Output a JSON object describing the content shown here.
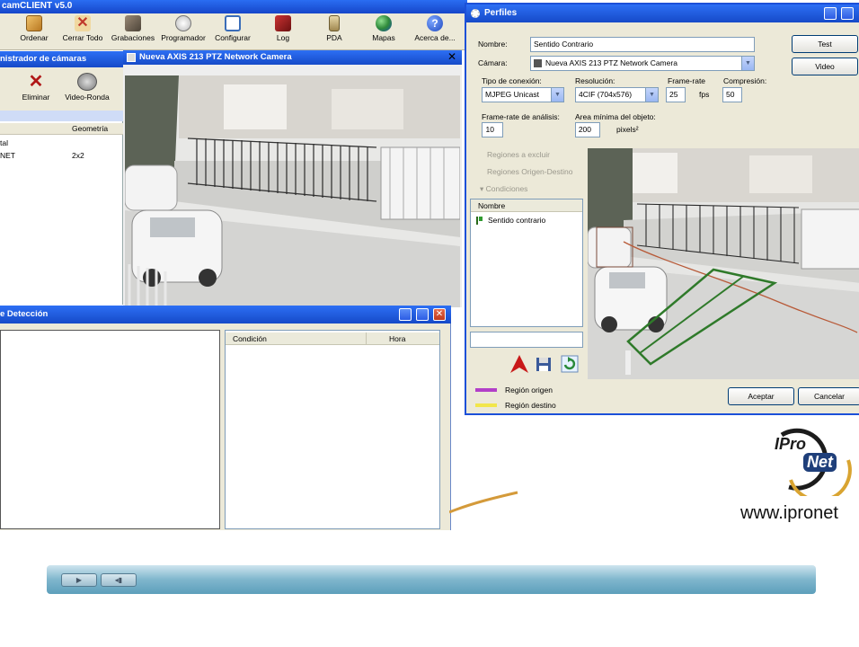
{
  "app": {
    "title": "camCLIENT v5.0",
    "toolbar": [
      {
        "label": "Ordenar",
        "icon": "ordenar-icon",
        "color": "#c98a2c"
      },
      {
        "label": "Cerrar Todo",
        "icon": "cerrar-todo-icon",
        "color": "#c0392b"
      },
      {
        "label": "Grabaciones",
        "icon": "grabaciones-icon",
        "color": "#7a6a5a"
      },
      {
        "label": "Programador",
        "icon": "programador-icon",
        "color": "#b0b0b0"
      },
      {
        "label": "Configurar",
        "icon": "configurar-icon",
        "color": "#3a6db8"
      },
      {
        "label": "Log",
        "icon": "log-icon",
        "color": "#8b1a1a"
      },
      {
        "label": "PDA",
        "icon": "pda-icon",
        "color": "#c9b27a"
      },
      {
        "label": "Mapas",
        "icon": "globe-icon",
        "color": "#2f8a3a"
      },
      {
        "label": "Acerca de...",
        "icon": "help-icon",
        "color": "#2a5cc8"
      }
    ]
  },
  "cam_admin": {
    "title": "nistrador de cámaras",
    "tools": [
      {
        "label": "Eliminar",
        "icon": "delete-x-icon"
      },
      {
        "label": "Video-Ronda",
        "icon": "video-ronda-icon"
      }
    ],
    "columns": [
      "Geometría"
    ],
    "rows": [
      {
        "name": "tal",
        "geometry": ""
      },
      {
        "name": "NET",
        "geometry": "2x2"
      }
    ]
  },
  "camera_window": {
    "title": "Nueva AXIS 213 PTZ Network Camera"
  },
  "detection_window": {
    "title": "e Detección",
    "columns": [
      "Condición",
      "Hora"
    ]
  },
  "perfiles": {
    "title": "Perfiles",
    "nombre_label": "Nombre:",
    "nombre_value": "Sentido Contrario",
    "camara_label": "Cámara:",
    "camara_value": "Nueva AXIS 213 PTZ Network Camera",
    "tipo_label": "Tipo de conexión:",
    "tipo_value": "MJPEG Unicast",
    "resolucion_label": "Resolución:",
    "resolucion_value": "4CIF (704x576)",
    "framerate_label": "Frame-rate",
    "framerate_value": "25",
    "fps": "fps",
    "compresion_label": "Compresión:",
    "compresion_value": "50",
    "fr_analisis_label": "Frame-rate de análisis:",
    "fr_analisis_value": "10",
    "area_label": "Area mínima del objeto:",
    "area_value": "200",
    "pixels": "pixels²",
    "tree": [
      "Regiones a excluir",
      "Regiones Origen-Destino",
      "Condiciones"
    ],
    "list_header": "Nombre",
    "list_items": [
      "Sentido contrario"
    ],
    "test": "Test",
    "video": "Video",
    "aceptar": "Aceptar",
    "cancelar": "Cancelar",
    "legend": [
      {
        "label": "Región origen",
        "color": "#b23fc8"
      },
      {
        "label": "Región destino",
        "color": "#f2e64a"
      }
    ]
  },
  "brand": {
    "logo_text_top": "IPro",
    "logo_text_bottom": "Net",
    "url": "www.ipronet"
  }
}
